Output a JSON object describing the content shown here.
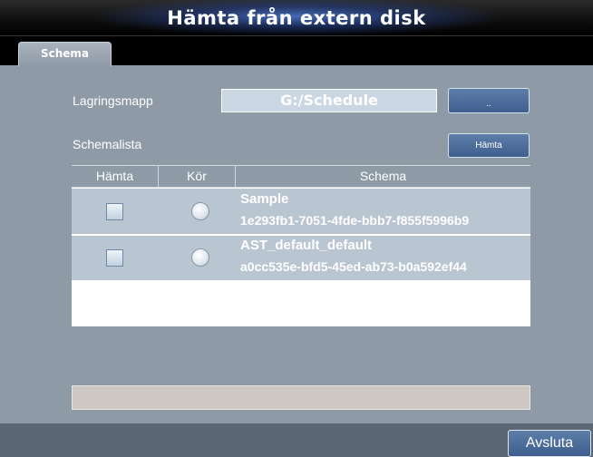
{
  "window": {
    "title": "Hämta  från extern disk"
  },
  "tabs": [
    {
      "label": "Schema"
    }
  ],
  "storage": {
    "label": "Lagringsmapp",
    "path": "G:/Schedule",
    "browse_label": ".."
  },
  "schedule_list": {
    "label": "Schemalista",
    "fetch_button_label": "Hämta",
    "columns": [
      "Hämta",
      "Kör",
      "Schema"
    ],
    "rows": [
      {
        "name": "Sample",
        "id": "1e293fb1-7051-4fde-bbb7-f855f5996b9"
      },
      {
        "name": "AST_default_default",
        "id": "a0cc535e-bfd5-45ed-ab73-b0a592ef44"
      }
    ]
  },
  "status": {
    "text": ""
  },
  "footer": {
    "close_label": "Avsluta"
  }
}
